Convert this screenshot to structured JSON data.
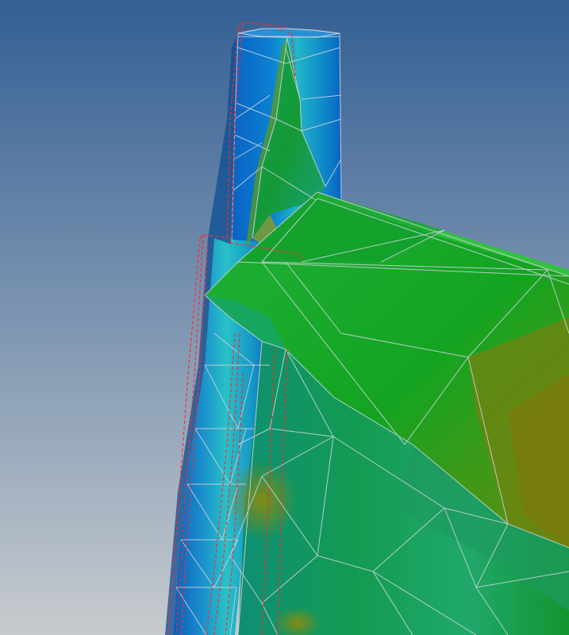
{
  "viewport": {
    "background_top": "#335f94",
    "background_bottom": "#c7cbce"
  },
  "colors": {
    "column_blue": "#0a63c4",
    "column_cyan": "#21b6c8",
    "shell_green": "#12a01e",
    "shell_green_dark": "#08892a",
    "shell_olive": "#6c8a10",
    "shell_teal": "#1b9f7e",
    "mesh_edge": "#c8d2d8",
    "deformed_outline": "#ff2a2a"
  },
  "icons": {
    "column": "column-mesh-icon",
    "shell": "shell-mesh-icon"
  }
}
